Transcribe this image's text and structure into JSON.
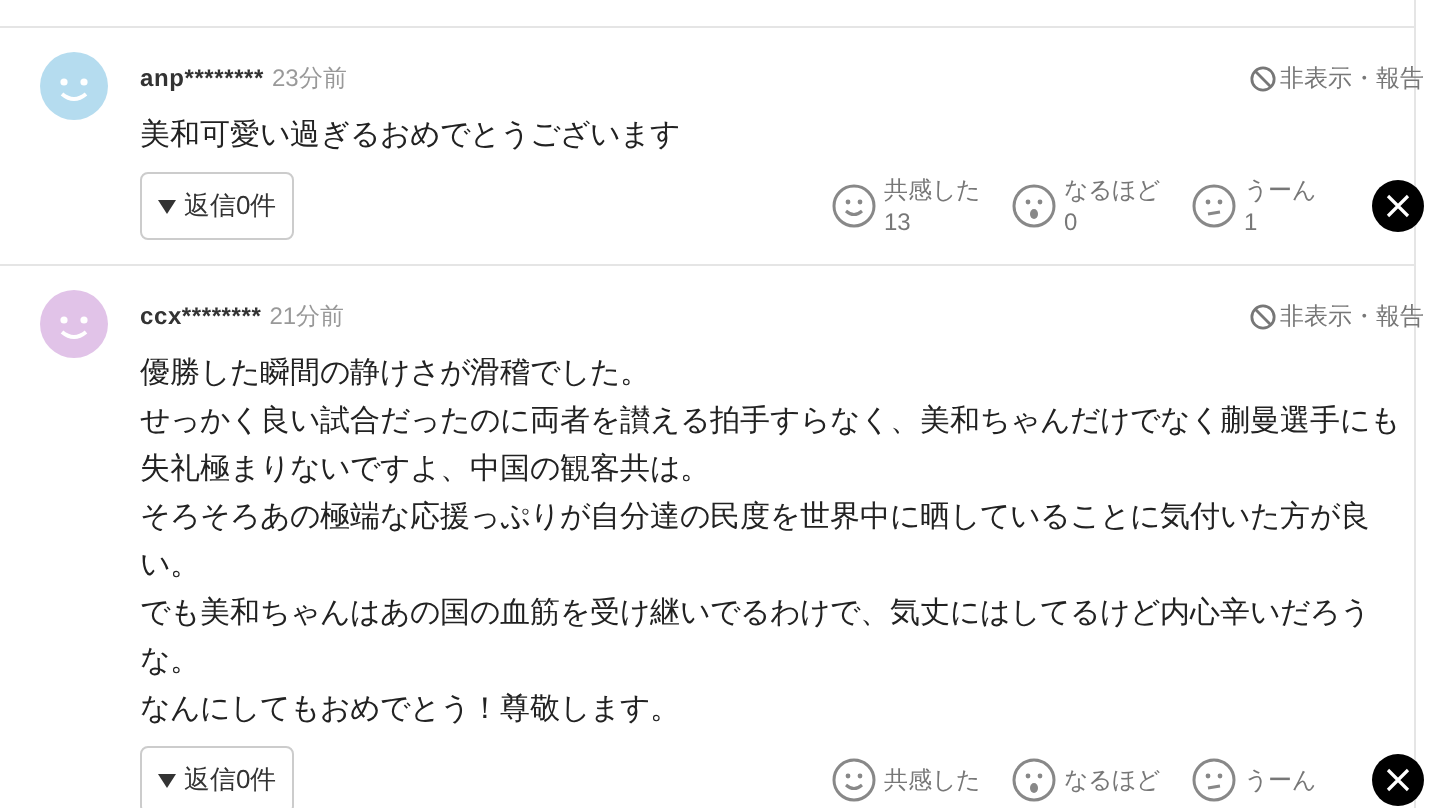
{
  "comments": [
    {
      "color": "#b5dcef",
      "user": "anp********",
      "time": "23分前",
      "hide_report": "非表示・報告",
      "lines": [
        "美和可愛い過ぎるおめでとうございます"
      ],
      "reply_button": "返信0件",
      "reactions": [
        {
          "kind": "smile",
          "label": "共感した",
          "count": "13"
        },
        {
          "kind": "surprised",
          "label": "なるほど",
          "count": "0"
        },
        {
          "kind": "doubt",
          "label": "うーん",
          "count": "1"
        }
      ]
    },
    {
      "color": "#e1c3e8",
      "user": "ccx********",
      "time": "21分前",
      "hide_report": "非表示・報告",
      "lines": [
        "優勝した瞬間の静けさが滑稽でした。",
        "せっかく良い試合だったのに両者を讃える拍手すらなく、美和ちゃんだけでなく蒯曼選手にも失礼極まりないですよ、中国の観客共は。",
        "そろそろあの極端な応援っぷりが自分達の民度を世界中に晒していることに気付いた方が良い。",
        "でも美和ちゃんはあの国の血筋を受け継いでるわけで、気丈にはしてるけど内心辛いだろうな。",
        "なんにしてもおめでとう！尊敬します。"
      ],
      "reply_button": "返信0件",
      "reactions": [
        {
          "kind": "smile",
          "label": "共感した"
        },
        {
          "kind": "surprised",
          "label": "なるほど"
        },
        {
          "kind": "doubt",
          "label": "うーん"
        }
      ]
    }
  ]
}
